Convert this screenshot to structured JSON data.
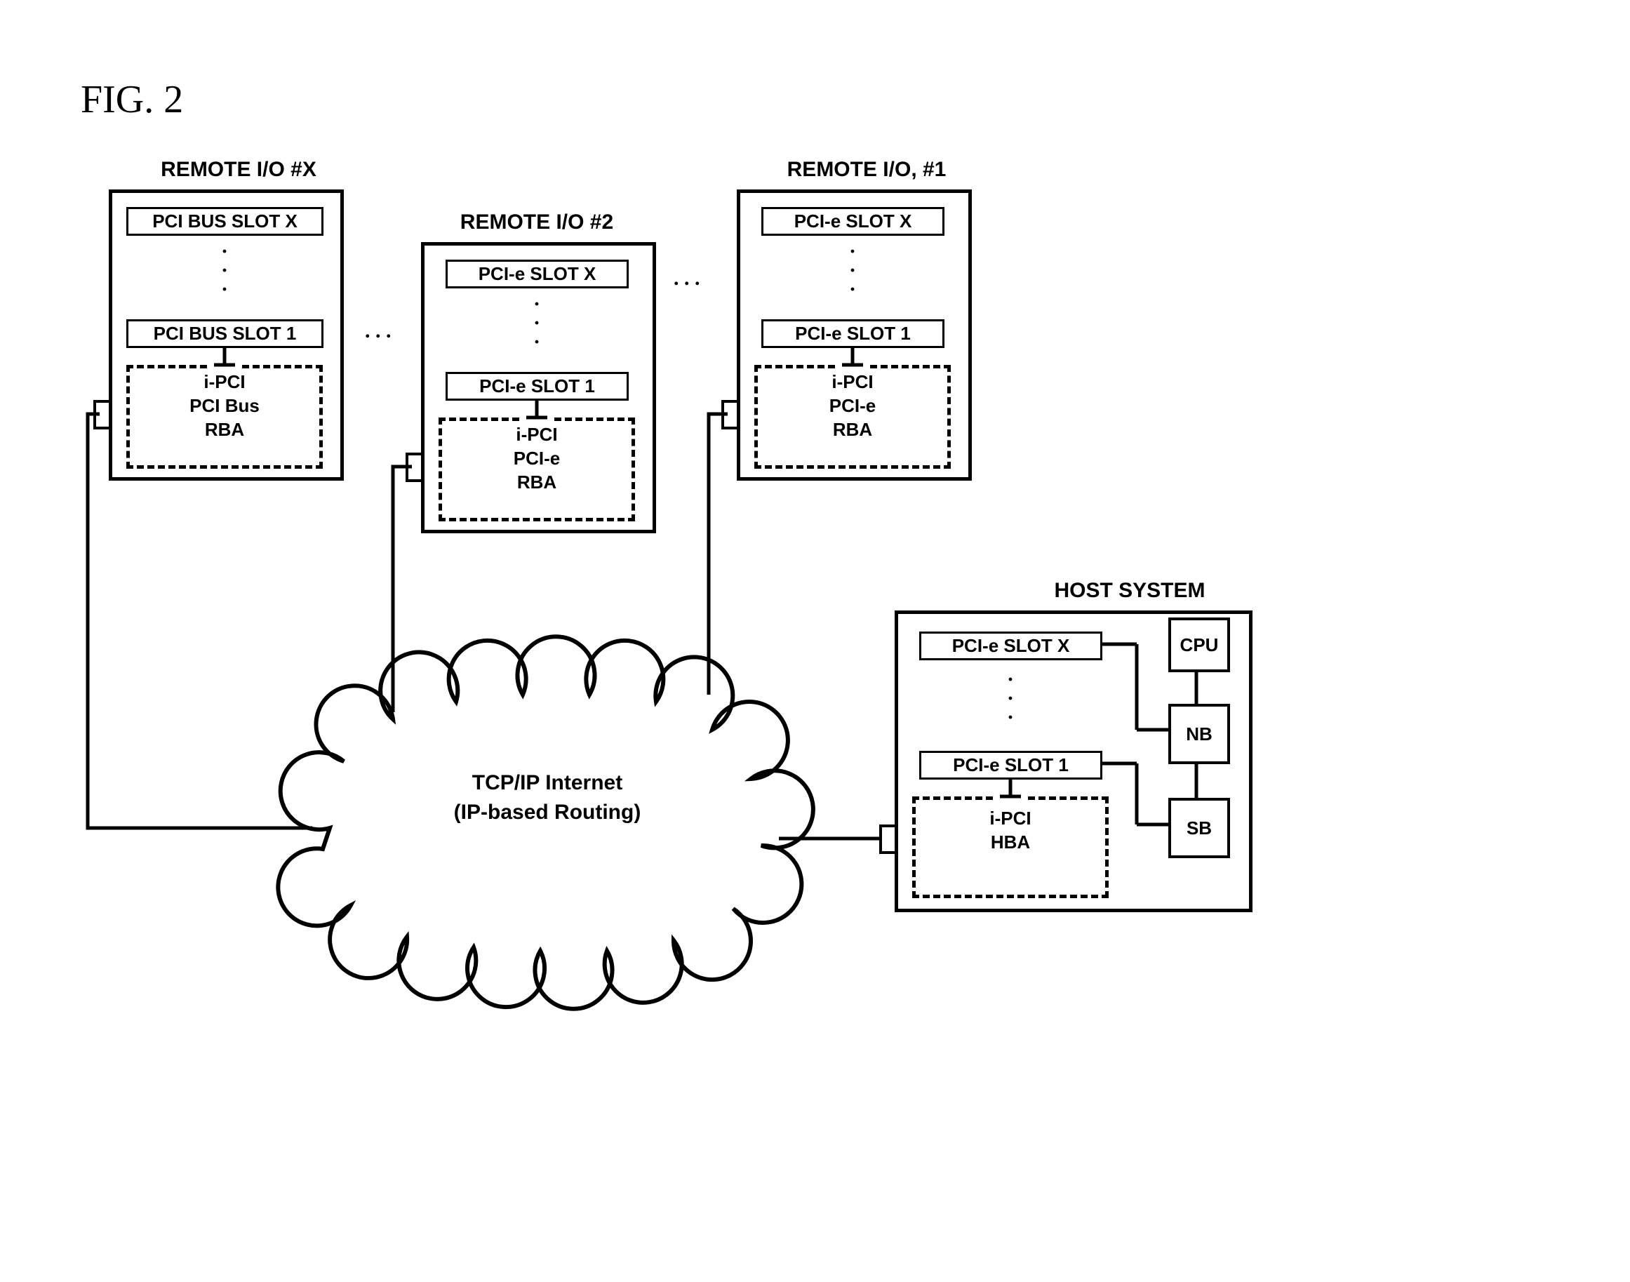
{
  "figure_label": "FIG. 2",
  "remote_x": {
    "title": "REMOTE I/O #X",
    "slot_top": "PCI BUS SLOT X",
    "slot_bottom": "PCI BUS SLOT 1",
    "adapter_l1": "i-PCI",
    "adapter_l2": "PCI Bus",
    "adapter_l3": "RBA"
  },
  "remote_2": {
    "title": "REMOTE I/O #2",
    "slot_top": "PCI-e SLOT X",
    "slot_bottom": "PCI-e SLOT 1",
    "adapter_l1": "i-PCI",
    "adapter_l2": "PCI-e",
    "adapter_l3": "RBA"
  },
  "remote_1": {
    "title": "REMOTE I/O, #1",
    "slot_top": "PCI-e SLOT X",
    "slot_bottom": "PCI-e SLOT 1",
    "adapter_l1": "i-PCI",
    "adapter_l2": "PCI-e",
    "adapter_l3": "RBA"
  },
  "host": {
    "title": "HOST SYSTEM",
    "slot_top": "PCI-e SLOT X",
    "slot_bottom": "PCI-e SLOT 1",
    "adapter_l1": "i-PCI",
    "adapter_l2": "HBA",
    "cpu": "CPU",
    "nb": "NB",
    "sb": "SB"
  },
  "cloud": {
    "line1": "TCP/IP Internet",
    "line2": "(IP-based Routing)"
  },
  "ellipsis": ". . ."
}
